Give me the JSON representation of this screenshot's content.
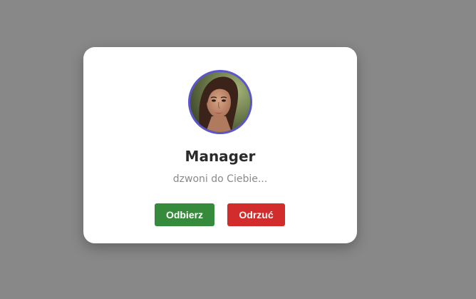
{
  "call": {
    "caller_name": "Manager",
    "status": "dzwoni do Ciebie...",
    "accept_label": "Odbierz",
    "decline_label": "Odrzuć"
  },
  "colors": {
    "backdrop": "#888888",
    "card": "#ffffff",
    "avatar_ring": "#5a55c9",
    "accept": "#368a3c",
    "decline": "#d32c2c"
  }
}
